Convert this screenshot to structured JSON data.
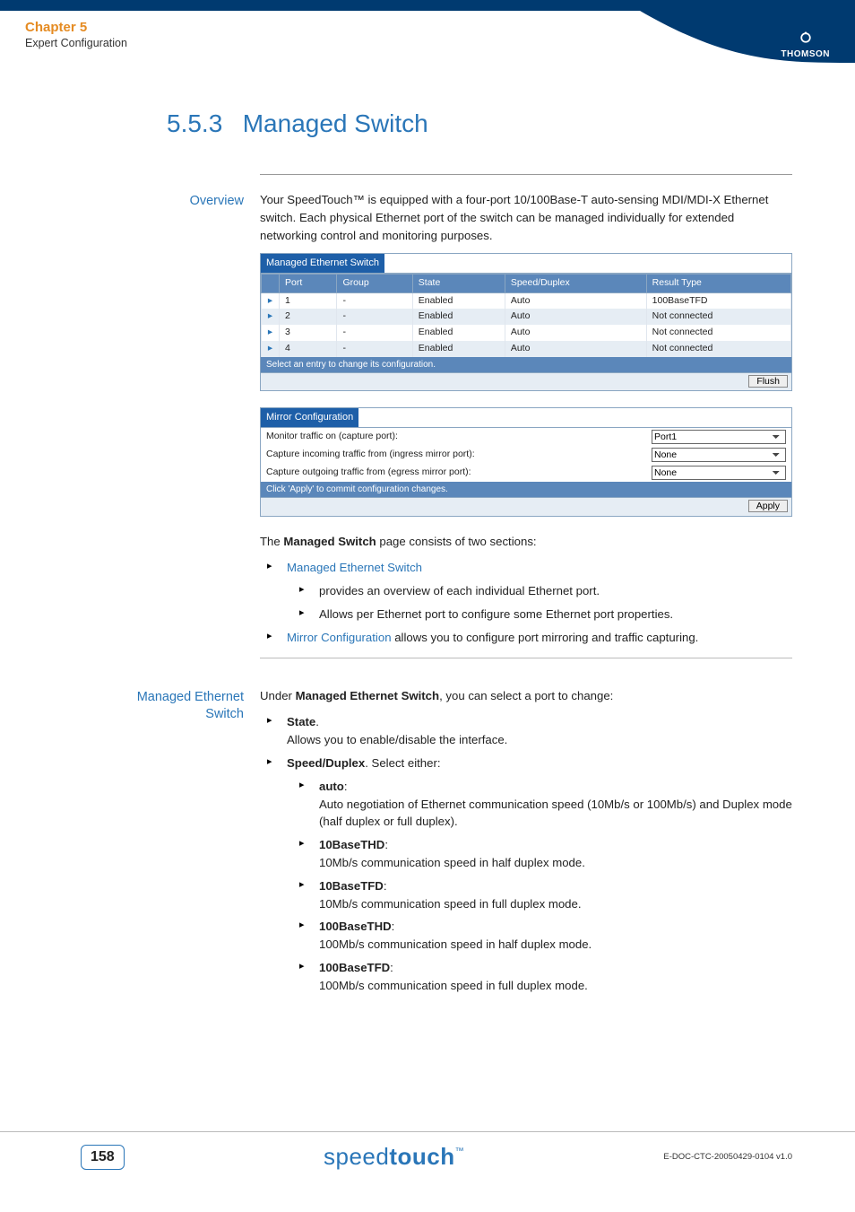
{
  "header": {
    "chapter": "Chapter 5",
    "subtitle": "Expert Configuration",
    "brand": "THOMSON"
  },
  "section": {
    "number": "5.5.3",
    "title": "Managed Switch"
  },
  "overview": {
    "label": "Overview",
    "paragraph": "Your SpeedTouch™ is equipped with a four-port 10/100Base-T auto-sensing MDI/MDI-X Ethernet switch. Each physical Ethernet port of the switch can be managed individually for extended networking control and monitoring purposes."
  },
  "mes_panel": {
    "title": "Managed Ethernet Switch",
    "columns": {
      "c0": "",
      "c1": "Port",
      "c2": "Group",
      "c3": "State",
      "c4": "Speed/Duplex",
      "c5": "Result Type"
    },
    "rows": [
      {
        "port": "1",
        "group": "-",
        "state": "Enabled",
        "speed": "Auto",
        "result": "100BaseTFD"
      },
      {
        "port": "2",
        "group": "-",
        "state": "Enabled",
        "speed": "Auto",
        "result": "Not connected"
      },
      {
        "port": "3",
        "group": "-",
        "state": "Enabled",
        "speed": "Auto",
        "result": "Not connected"
      },
      {
        "port": "4",
        "group": "-",
        "state": "Enabled",
        "speed": "Auto",
        "result": "Not connected"
      }
    ],
    "hint": "Select an entry to change its configuration.",
    "flush": "Flush"
  },
  "mirror_panel": {
    "title": "Mirror Configuration",
    "rows": {
      "r0": {
        "label": "Monitor traffic on (capture port):",
        "value": "Port1"
      },
      "r1": {
        "label": "Capture incoming traffic from (ingress mirror port):",
        "value": "None"
      },
      "r2": {
        "label": "Capture outgoing traffic from (egress mirror port):",
        "value": "None"
      }
    },
    "hint": "Click 'Apply' to commit configuration changes.",
    "apply": "Apply"
  },
  "sections_intro": "The Managed Switch page consists of two sections:",
  "sections_intro_prefix": "The ",
  "sections_intro_bold": "Managed Switch",
  "sections_intro_suffix": " page consists of two sections:",
  "sec_list": {
    "i0": "Managed Ethernet Switch",
    "i0a": "provides an overview of each individual Ethernet port.",
    "i0b": "Allows per Ethernet port to configure some Ethernet port properties.",
    "i1_link": "Mirror Configuration",
    "i1_rest": " allows you to configure port mirroring and traffic capturing."
  },
  "mes_block": {
    "label": "Managed Ethernet Switch",
    "intro_prefix": "Under ",
    "intro_bold": "Managed Ethernet Switch",
    "intro_suffix": ", you can select a port to change:",
    "state_label": "State",
    "state_desc": "Allows you to enable/disable the interface.",
    "sd_label": "Speed/Duplex",
    "sd_suffix": ". Select either:",
    "opts": {
      "auto_t": "auto",
      "auto_d": "Auto negotiation of Ethernet communication speed (10Mb/s or 100Mb/s) and Duplex mode (half duplex or full duplex).",
      "thd10_t": "10BaseTHD",
      "thd10_d": "10Mb/s communication speed in half duplex mode.",
      "tfd10_t": "10BaseTFD",
      "tfd10_d": "10Mb/s communication speed in full duplex mode.",
      "thd100_t": "100BaseTHD",
      "thd100_d": "100Mb/s communication speed in half duplex mode.",
      "tfd100_t": "100BaseTFD",
      "tfd100_d": "100Mb/s communication speed in full duplex mode."
    }
  },
  "footer": {
    "page": "158",
    "brand_light": "speed",
    "brand_bold": "touch",
    "tm": "™",
    "docid": "E-DOC-CTC-20050429-0104 v1.0"
  }
}
